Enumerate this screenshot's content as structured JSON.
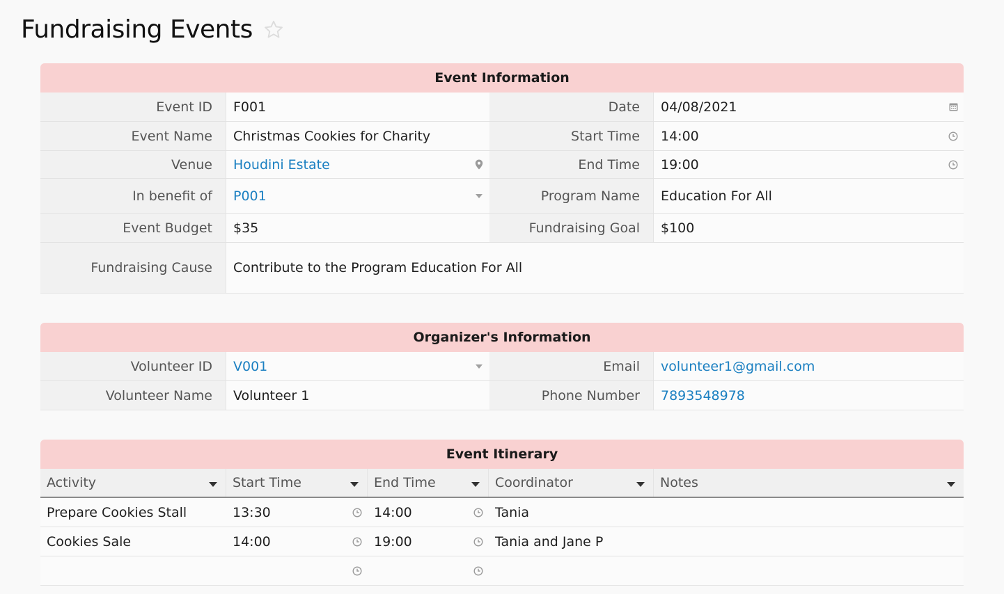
{
  "page": {
    "title": "Fundraising Events"
  },
  "event_info": {
    "header": "Event Information",
    "event_id": {
      "label": "Event ID",
      "value": "F001"
    },
    "date": {
      "label": "Date",
      "value": "04/08/2021"
    },
    "event_name": {
      "label": "Event Name",
      "value": "Christmas Cookies for Charity"
    },
    "start_time": {
      "label": "Start Time",
      "value": "14:00"
    },
    "venue": {
      "label": "Venue",
      "value": "Houdini Estate"
    },
    "end_time": {
      "label": "End Time",
      "value": "19:00"
    },
    "in_benefit_of": {
      "label": "In benefit of",
      "value": "P001"
    },
    "program_name": {
      "label": "Program Name",
      "value": "Education For All"
    },
    "event_budget": {
      "label": "Event Budget",
      "value": "$35"
    },
    "fundraising_goal": {
      "label": "Fundraising Goal",
      "value": "$100"
    },
    "fundraising_cause": {
      "label": "Fundraising Cause",
      "value": "Contribute to the Program Education For All"
    }
  },
  "organizer_info": {
    "header": "Organizer's Information",
    "volunteer_id": {
      "label": "Volunteer ID",
      "value": "V001"
    },
    "email": {
      "label": "Email",
      "value": "volunteer1@gmail.com"
    },
    "volunteer_name": {
      "label": "Volunteer Name",
      "value": "Volunteer 1"
    },
    "phone_number": {
      "label": "Phone Number",
      "value": "7893548978"
    }
  },
  "itinerary": {
    "header": "Event Itinerary",
    "columns": [
      "Activity",
      "Start Time",
      "End Time",
      "Coordinator",
      "Notes"
    ],
    "rows": [
      {
        "activity": "Prepare Cookies Stall",
        "start": "13:30",
        "end": "14:00",
        "coordinator": "Tania",
        "notes": ""
      },
      {
        "activity": "Cookies Sale",
        "start": "14:00",
        "end": "19:00",
        "coordinator": "Tania and Jane P",
        "notes": ""
      },
      {
        "activity": "",
        "start": "",
        "end": "",
        "coordinator": "",
        "notes": ""
      }
    ]
  },
  "colors": {
    "section_header_bg": "#f9d1d1",
    "link": "#1a7fc1",
    "label_bg": "#f1f1f1"
  },
  "icons": {
    "title": "star-outline-icon",
    "date": "calendar-icon",
    "time": "clock-icon",
    "venue": "map-pin-icon",
    "dropdown": "caret-down-icon"
  }
}
